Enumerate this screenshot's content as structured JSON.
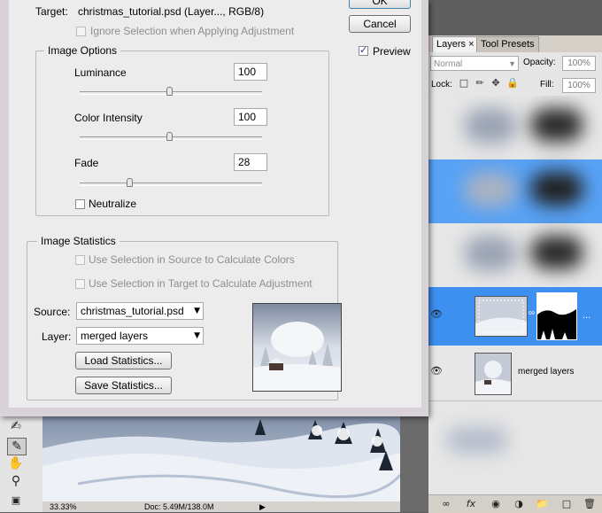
{
  "dialog": {
    "target_label": "Target:",
    "target_value": "christmas_tutorial.psd (Layer..., RGB/8)",
    "ignore_selection": "Ignore Selection when Applying Adjustment",
    "ok_label": "OK",
    "cancel_label": "Cancel",
    "preview_label": "Preview",
    "preview_checked": true,
    "image_options": {
      "title": "Image Options",
      "luminance_label": "Luminance",
      "luminance_value": "100",
      "color_intensity_label": "Color Intensity",
      "color_intensity_value": "100",
      "fade_label": "Fade",
      "fade_value": "28",
      "neutralize_label": "Neutralize",
      "neutralize_checked": false
    },
    "image_statistics": {
      "title": "Image Statistics",
      "use_source": "Use Selection in Source to Calculate Colors",
      "use_target": "Use Selection in Target to Calculate Adjustment",
      "source_label": "Source:",
      "source_value": "christmas_tutorial.psd",
      "layer_label": "Layer:",
      "layer_value": "merged layers",
      "load_button": "Load Statistics...",
      "save_button": "Save Statistics..."
    }
  },
  "layers_panel": {
    "tabs": [
      "Layers",
      "Tool Presets"
    ],
    "blend_mode": "Normal",
    "opacity_label": "Opacity:",
    "opacity_value": "100%",
    "lock_label": "Lock:",
    "fill_label": "Fill:",
    "fill_value": "100%",
    "merged_layer_name": "merged layers",
    "active_layer_ellipsis": "..."
  },
  "status_bar": {
    "zoom": "33.33%",
    "doc": "Doc: 5.49M/138.0M"
  },
  "icons": [
    "eye-icon",
    "link-icon",
    "fx-icon",
    "mask-icon",
    "adjustment-icon",
    "folder-icon",
    "new-layer-icon",
    "trash-icon",
    "eyedropper-icon",
    "hand-icon",
    "zoom-icon"
  ],
  "colors": {
    "selection": "#3d8ff0",
    "dialog_bg": "#ececec",
    "panel_bg": "#d4d0c8"
  }
}
